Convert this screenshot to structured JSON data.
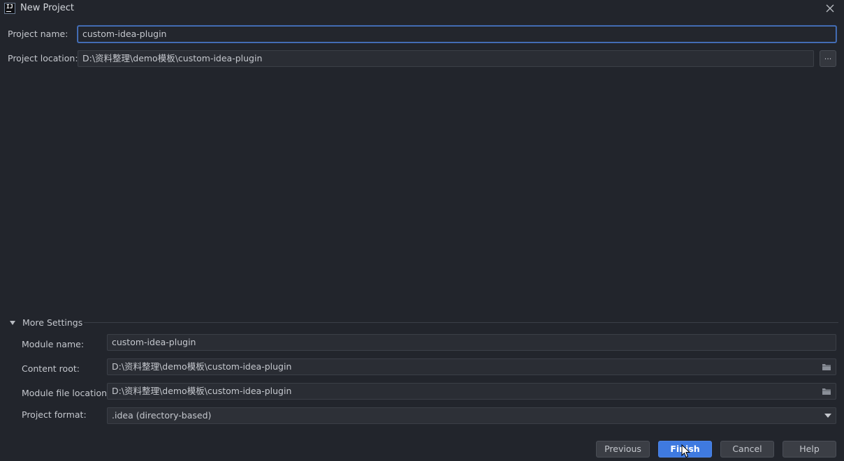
{
  "window": {
    "title": "New Project"
  },
  "project": {
    "name_label": "Project name:",
    "name_value": "custom-idea-plugin",
    "location_label": "Project location:",
    "location_value": "D:\\资料整理\\demo模板\\custom-idea-plugin",
    "browse_label": "..."
  },
  "more_settings": {
    "label": "More Settings",
    "module_name_label": "Module name:",
    "module_name_value": "custom-idea-plugin",
    "content_root_label": "Content root:",
    "content_root_value": "D:\\资料整理\\demo模板\\custom-idea-plugin",
    "module_file_label": "Module file location:",
    "module_file_value": "D:\\资料整理\\demo模板\\custom-idea-plugin",
    "format_label": "Project format:",
    "format_value": ".idea (directory-based)"
  },
  "buttons": {
    "previous": "Previous",
    "finish": "Finish",
    "cancel": "Cancel",
    "help": "Help"
  },
  "colors": {
    "background": "#22252c",
    "accent": "#3f7ae0",
    "focus_border": "#4b79c8"
  }
}
